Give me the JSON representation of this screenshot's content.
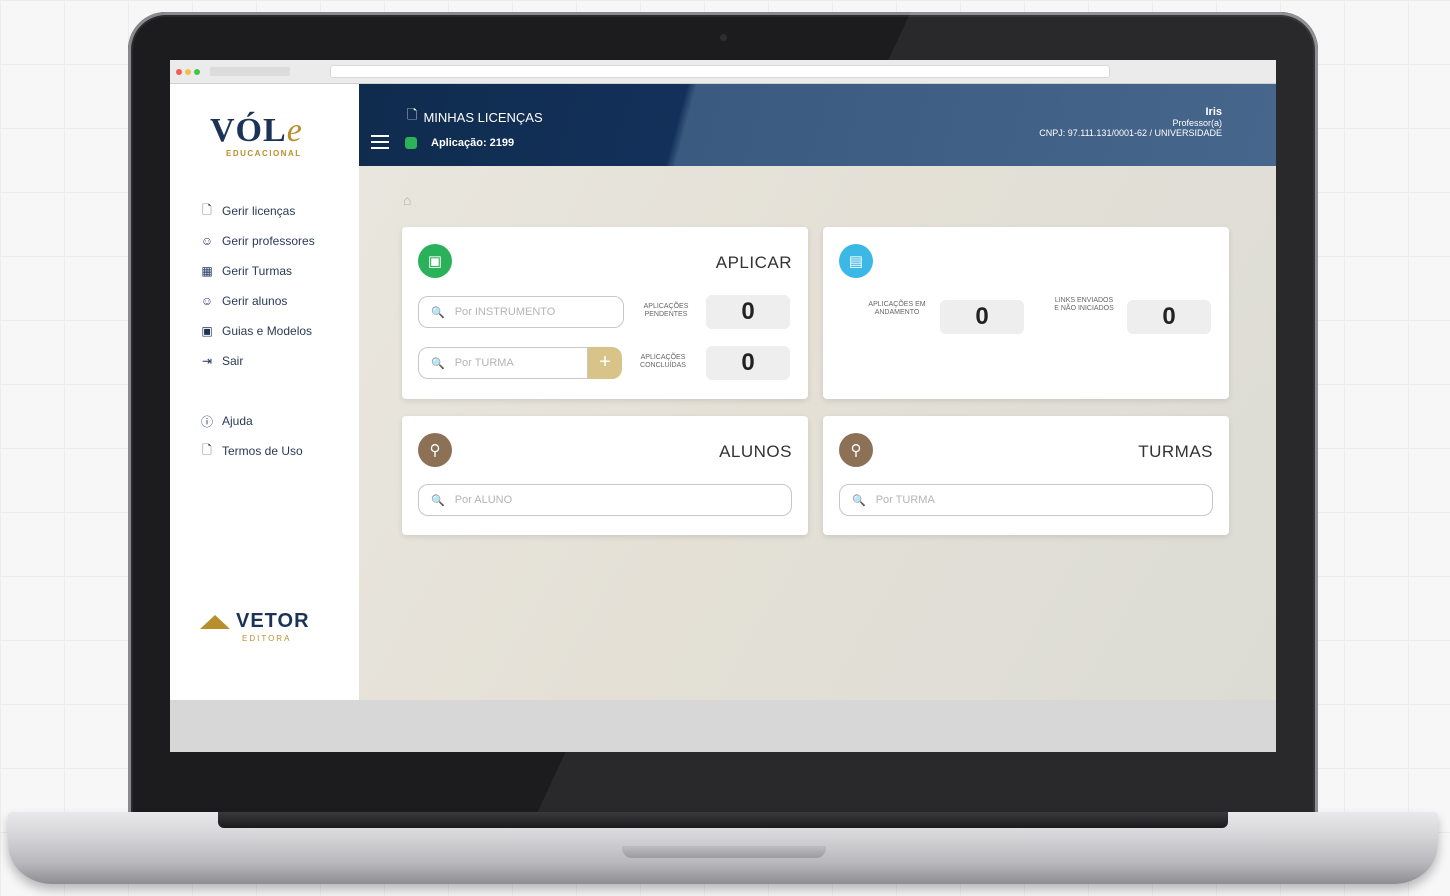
{
  "sidebar": {
    "logo": {
      "brand_a": "VÓL",
      "brand_b": "e",
      "subtitle": "EDUCACIONAL"
    },
    "items": [
      {
        "icon": "document-icon",
        "glyph": "🗋",
        "label": "Gerir licenças"
      },
      {
        "icon": "user-icon",
        "glyph": "👤",
        "label": "Gerir professores"
      },
      {
        "icon": "grid-icon",
        "glyph": "▦",
        "label": "Gerir Turmas"
      },
      {
        "icon": "user-icon",
        "glyph": "👤",
        "label": "Gerir alunos"
      },
      {
        "icon": "archive-icon",
        "glyph": "▣",
        "label": "Guias e Modelos"
      },
      {
        "icon": "logout-icon",
        "glyph": "⇥",
        "label": "Sair"
      }
    ],
    "secondary": [
      {
        "icon": "help-icon",
        "glyph": "?",
        "label": "Ajuda"
      },
      {
        "icon": "document-icon",
        "glyph": "🗋",
        "label": "Termos de Uso"
      }
    ],
    "footer_logo": {
      "name": "VETOR",
      "sub": "EDITORA"
    }
  },
  "header": {
    "title": "MINHAS LICENÇAS",
    "application": "Aplicação: 2199",
    "user": {
      "name": "Iris",
      "role": "Professor(a)",
      "cnpj": "CNPJ: 97.111.131/0001-62 / UNIVERSIDADE"
    }
  },
  "cards": {
    "aplicar": {
      "title": "APLICAR",
      "search_instrument": "Por INSTRUMENTO",
      "search_turma": "Por TURMA",
      "pending_label": "APLICAÇÕES PENDENTES",
      "pending_value": "0",
      "completed_label": "APLICAÇÕES CONCLUÍDAS",
      "completed_value": "0"
    },
    "status": {
      "in_progress_label": "APLICAÇÕES EM ANDAMENTO",
      "in_progress_value": "0",
      "links_label": "LINKS ENVIADOS E NÃO INICIADOS",
      "links_value": "0"
    },
    "alunos": {
      "title": "ALUNOS",
      "search": "Por ALUNO"
    },
    "turmas": {
      "title": "TURMAS",
      "search": "Por TURMA"
    }
  },
  "colors": {
    "header_dark": "#0f2c4e",
    "accent_green": "#2bb15a",
    "accent_blue": "#3bb8e6",
    "accent_brown": "#8c7156",
    "accent_gold": "#d8c389"
  }
}
